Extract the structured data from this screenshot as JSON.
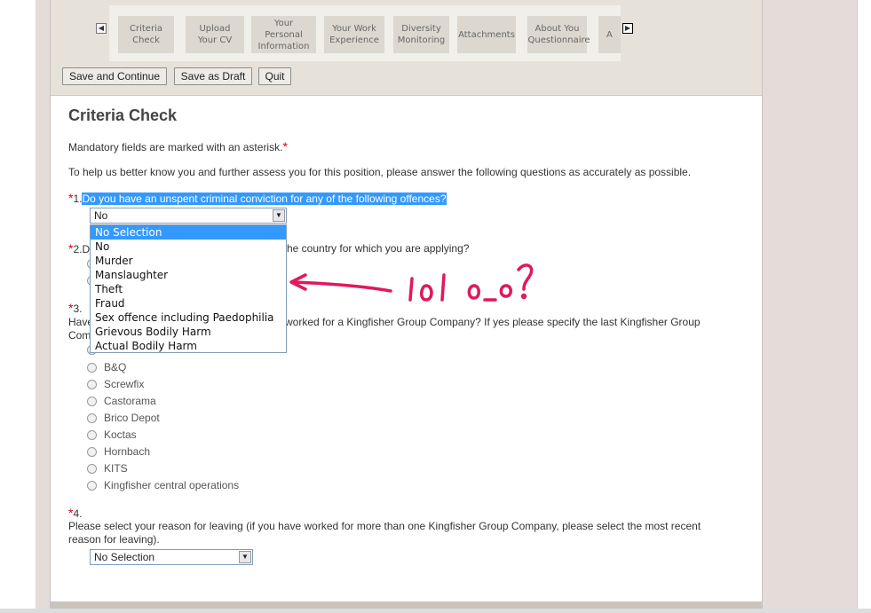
{
  "steps": {
    "items": [
      {
        "label": "Criteria Check",
        "active": true
      },
      {
        "label": "Upload Your CV"
      },
      {
        "label": "Your Personal Information"
      },
      {
        "label": "Your Work Experience"
      },
      {
        "label": "Diversity Monitoring"
      },
      {
        "label": "Attachments"
      },
      {
        "label": "About You Questionnaire"
      },
      {
        "label": "A"
      }
    ],
    "prev_icon": "chevron-left-icon",
    "next_icon": "chevron-right-icon"
  },
  "toolbar": {
    "save_continue": "Save and Continue",
    "save_draft": "Save as Draft",
    "quit": "Quit"
  },
  "page": {
    "title": "Criteria Check",
    "mandatory_note": "Mandatory fields are marked with an asterisk.",
    "asterisk": "*",
    "intro": "To help us better know you and further assess you for this position, please answer the following questions as accurately as possible."
  },
  "q1": {
    "number": "1.",
    "text": "Do you have an unspent criminal conviction for any of the following offences?",
    "selected": "No",
    "options": [
      "No Selection",
      "No",
      "Murder",
      "Manslaughter",
      "Theft",
      "Fraud",
      "Sex offence including Paedophilia",
      "Grievous Bodily Harm",
      "Actual Bodily Harm"
    ],
    "highlighted_option": "No Selection"
  },
  "q2": {
    "number": "2.",
    "text_prefix": "D",
    "text_visible": "he country for which you are applying?"
  },
  "q3": {
    "number": "3.",
    "text_prefix": "Have",
    "text_visible": "worked for a Kingfisher Group Company? If yes please specify the last Kingfisher Group",
    "text_line2_prefix": "Com",
    "options": [
      "B&Q",
      "Screwfix",
      "Castorama",
      "Brico Depot",
      "Koctas",
      "Hornbach",
      "KITS",
      "Kingfisher central operations"
    ]
  },
  "q4": {
    "number": "4.",
    "text": "Please select your reason for leaving (if you have worked for more than one Kingfisher Group Company, please select the most recent",
    "text_line2": "reason for leaving).",
    "selected": "No Selection"
  },
  "annotation": {
    "text": "lol o_o?",
    "color": "#e0195a"
  },
  "colors": {
    "asterisk": "#d0021b",
    "selection": "#3399ff",
    "header_bg": "#e6e2da"
  }
}
